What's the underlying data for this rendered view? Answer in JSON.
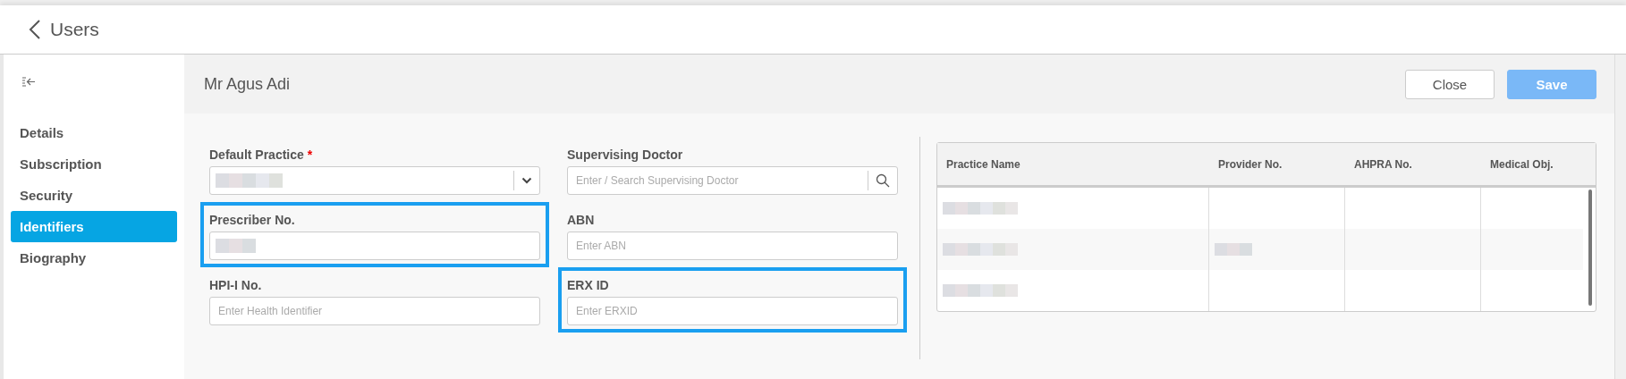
{
  "header": {
    "title": "Users"
  },
  "sidebar": {
    "items": [
      {
        "label": "Details",
        "selected": false
      },
      {
        "label": "Subscription",
        "selected": false
      },
      {
        "label": "Security",
        "selected": false
      },
      {
        "label": "Identifiers",
        "selected": true
      },
      {
        "label": "Biography",
        "selected": false
      }
    ]
  },
  "panel": {
    "title": "Mr Agus Adi",
    "buttons": [
      {
        "label": "Close",
        "kind": "secondary",
        "disabled": false
      },
      {
        "label": "Save",
        "kind": "primary",
        "disabled": true
      }
    ]
  },
  "form": {
    "fields": [
      {
        "label": "Default Practice",
        "required_mark": "*",
        "kind": "select",
        "redacted": true,
        "highlighted": false
      },
      {
        "label": "Supervising Doctor",
        "kind": "search",
        "placeholder": "Enter / Search Supervising Doctor",
        "redacted": false,
        "highlighted": false
      },
      {
        "label": "Prescriber No.",
        "kind": "text",
        "redacted": true,
        "highlighted": true
      },
      {
        "label": "ABN",
        "kind": "text",
        "placeholder": "Enter ABN",
        "redacted": false,
        "highlighted": false
      },
      {
        "label": "HPI-I No.",
        "kind": "text",
        "placeholder": "Enter Health Identifier",
        "redacted": false,
        "highlighted": false
      },
      {
        "label": "ERX ID",
        "kind": "text",
        "placeholder": "Enter ERXID",
        "redacted": false,
        "highlighted": true
      }
    ]
  },
  "table": {
    "columns": [
      "Practice Name",
      "Provider No.",
      "AHPRA No.",
      "Medical Obj."
    ],
    "rows": [
      {
        "cells": [
          {
            "redacted": true
          },
          {
            "redacted": false
          },
          {
            "redacted": false
          },
          {
            "redacted": false
          }
        ]
      },
      {
        "cells": [
          {
            "redacted": true
          },
          {
            "redacted": true
          },
          {
            "redacted": false
          },
          {
            "redacted": false
          }
        ]
      },
      {
        "cells": [
          {
            "redacted": true
          },
          {
            "redacted": false
          },
          {
            "redacted": false
          },
          {
            "redacted": false
          }
        ]
      }
    ]
  }
}
